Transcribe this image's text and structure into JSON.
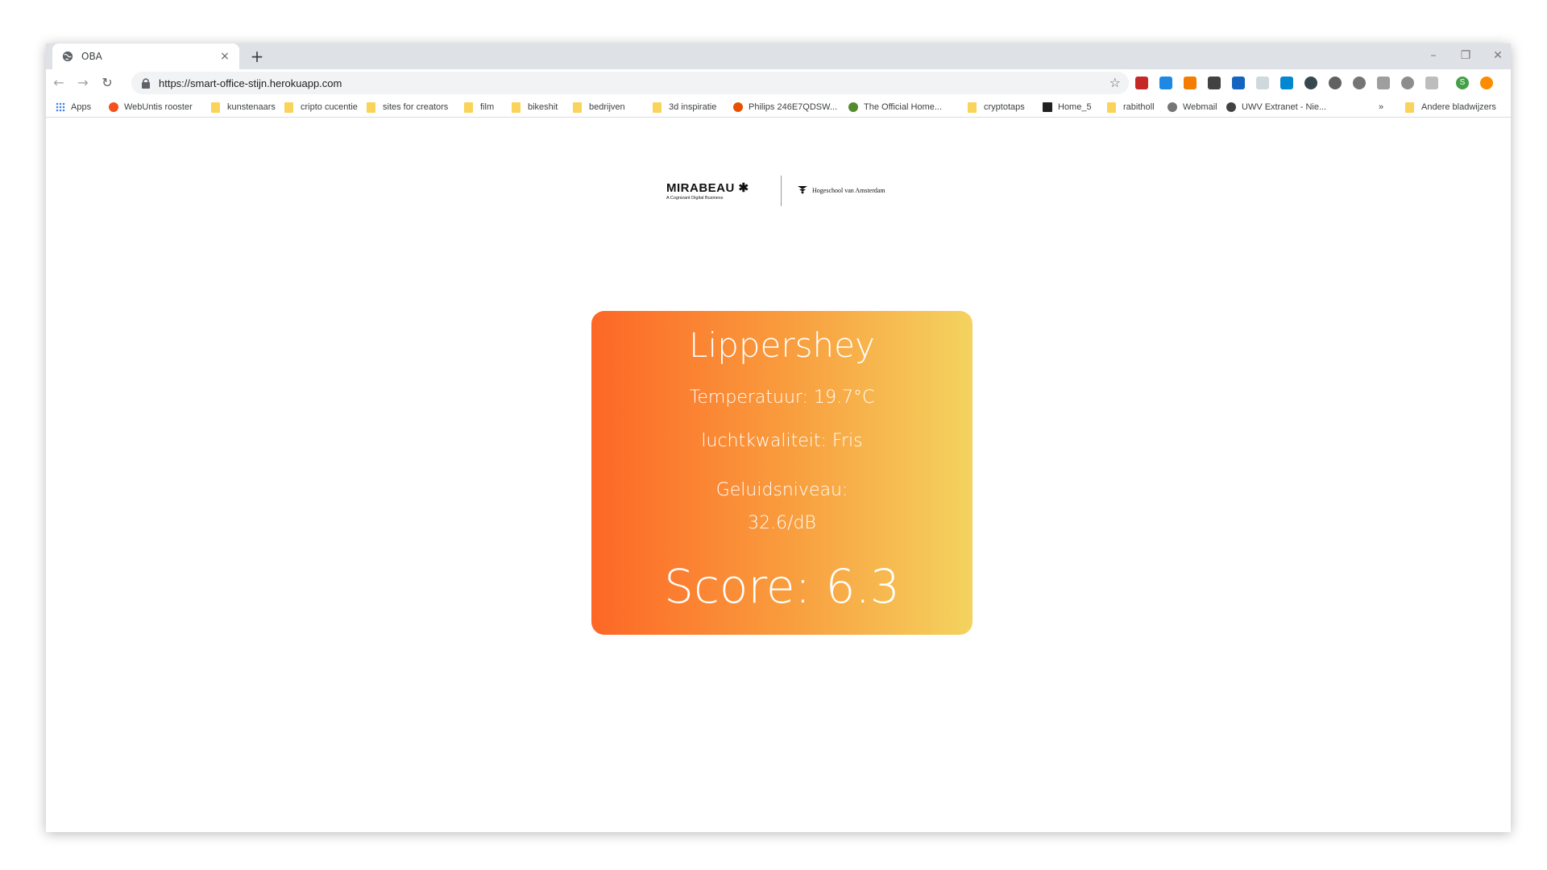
{
  "browser": {
    "tab_title": "OBA",
    "url": "https://smart-office-stijn.herokuapp.com",
    "new_tab_symbol": "+",
    "close_symbol": "×",
    "bookmarks": [
      {
        "label": "Apps",
        "icon": "apps-grid-icon"
      },
      {
        "label": "WebUntis rooster",
        "icon": "webuntis-icon"
      },
      {
        "label": "kunstenaars",
        "icon": "folder-icon"
      },
      {
        "label": "cripto cucentie",
        "icon": "folder-icon"
      },
      {
        "label": "sites for creators",
        "icon": "folder-icon"
      },
      {
        "label": "film",
        "icon": "folder-icon"
      },
      {
        "label": "bikeshit",
        "icon": "folder-icon"
      },
      {
        "label": "bedrijven",
        "icon": "folder-icon"
      },
      {
        "label": "3d inspiratie",
        "icon": "folder-icon"
      },
      {
        "label": "Philips 246E7QDSW...",
        "icon": "philips-icon"
      },
      {
        "label": "The Official Home...",
        "icon": "official-home-icon"
      },
      {
        "label": "cryptotaps",
        "icon": "folder-icon"
      },
      {
        "label": "Home_5",
        "icon": "home5-icon"
      },
      {
        "label": "rabitholl",
        "icon": "folder-icon"
      },
      {
        "label": "Webmail",
        "icon": "webmail-icon"
      },
      {
        "label": "UWV Extranet - Nie...",
        "icon": "globe-icon"
      }
    ],
    "overflow_label": "»",
    "other_bookmarks": "Andere bladwijzers",
    "profile_initial": "S"
  },
  "logos": {
    "mirabeau_name": "MIRABEAU",
    "mirabeau_star": "✱",
    "mirabeau_sub": "A Cognizant Digital Business",
    "hva_name": "Hogeschool van Amsterdam"
  },
  "room": {
    "name": "Lippershey",
    "temperature": "Temperatuur: 19.7°C",
    "air_quality": "luchtkwaliteit: Fris",
    "sound_level": "Geluidsniveau: 32.6/dB",
    "score": "Score: 6.3"
  },
  "colors": {
    "gradient_start": "#fd6726",
    "gradient_mid": "#f99b3d",
    "gradient_end": "#f4d35f"
  }
}
